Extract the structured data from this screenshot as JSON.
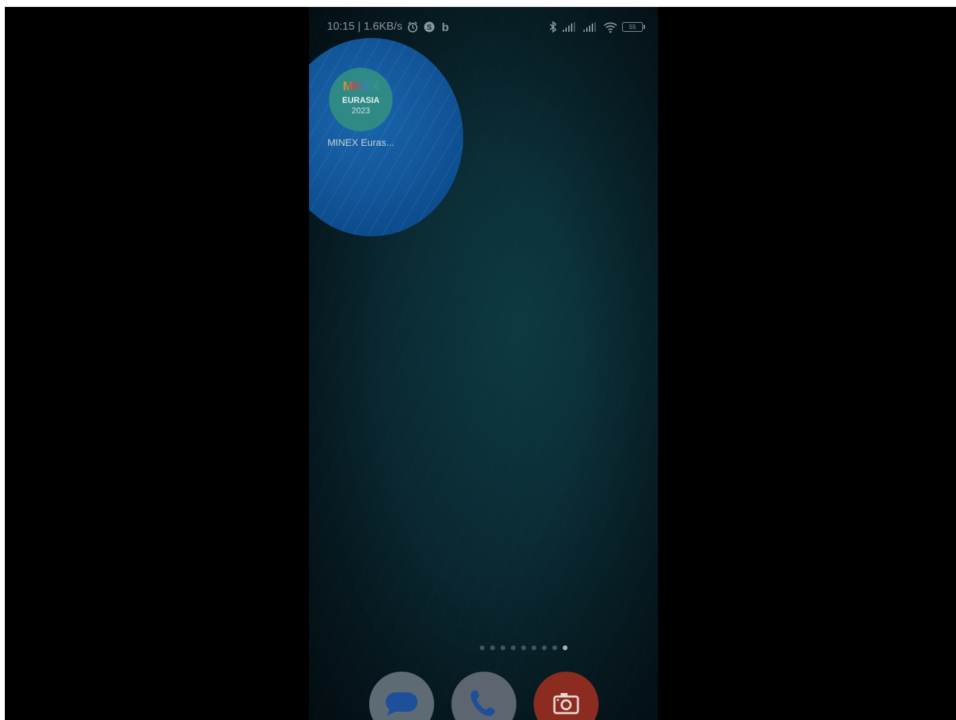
{
  "status_bar": {
    "time_speed": "10:15 | 1.6KB/s",
    "battery": "55",
    "icons_left": [
      "alarm-icon",
      "skype-icon",
      "b-app-icon"
    ],
    "icons_right": [
      "bluetooth-icon",
      "signal-icon",
      "signal-icon-2",
      "wifi-icon",
      "battery-icon"
    ]
  },
  "home_app": {
    "logo_text": "MINEX",
    "logo_sub1": "EURASIA",
    "logo_sub2": "2023",
    "label": "MINEX Euras..."
  },
  "pager": {
    "page_count": 9,
    "active_page": 9
  },
  "dock": {
    "apps": [
      "messages-icon",
      "phone-icon",
      "camera-icon"
    ]
  },
  "colors": {
    "ripple": "#145aa2",
    "camera_bg": "#8c2b20",
    "wallpaper": "#0b2d36"
  }
}
